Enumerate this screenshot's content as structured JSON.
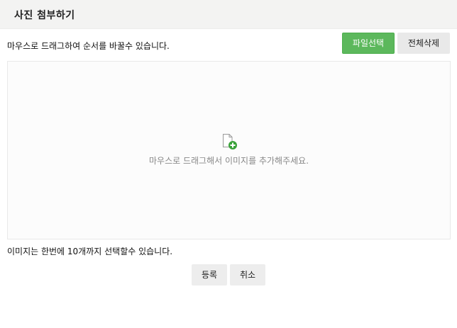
{
  "dialog": {
    "title": "사진 첨부하기"
  },
  "toolbar": {
    "hint": "마우스로 드래그하여 순서를 바꿀수 있습니다.",
    "select_file_label": "파일선택",
    "delete_all_label": "전체삭제"
  },
  "dropzone": {
    "icon": "add-file-icon",
    "message": "마우스로 드래그해서 이미지를 추가해주세요."
  },
  "footer": {
    "limit_hint": "이미지는 한번에 10개까지 선택할수 있습니다.",
    "register_label": "등록",
    "cancel_label": "취소"
  },
  "colors": {
    "primary_button": "#5cb85c",
    "secondary_button": "#e9e9e9",
    "header_bg": "#f3f3f2",
    "dropzone_bg": "#fcfcfc"
  }
}
